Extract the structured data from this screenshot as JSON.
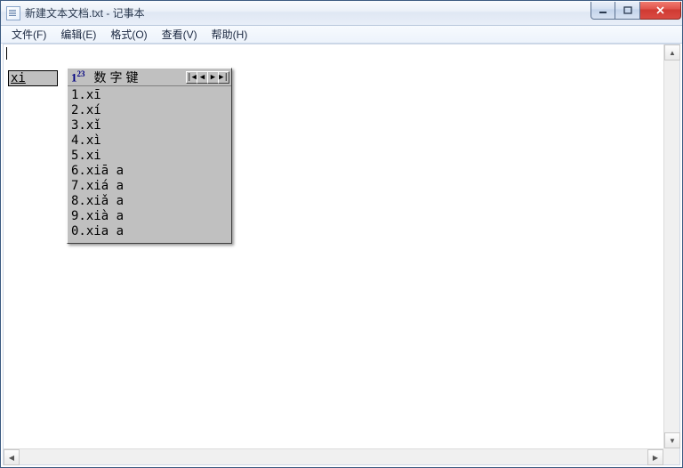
{
  "titlebar": {
    "title": "新建文本文档.txt - 记事本"
  },
  "menu": {
    "file": "文件(F)",
    "edit": "编辑(E)",
    "format": "格式(O)",
    "view": "查看(V)",
    "help": "帮助(H)"
  },
  "editor": {
    "content": ""
  },
  "ime": {
    "input": "xi",
    "mode_html": "1",
    "mode_sup": "23",
    "panel_title": "数字键",
    "nav": {
      "first": "|◀",
      "prev": "◀",
      "next": "▶",
      "last": "▶|"
    },
    "candidates": [
      {
        "n": "1",
        "text": "xī"
      },
      {
        "n": "2",
        "text": "xí"
      },
      {
        "n": "3",
        "text": "xǐ"
      },
      {
        "n": "4",
        "text": "xì"
      },
      {
        "n": "5",
        "text": "xi"
      },
      {
        "n": "6",
        "text": "xiā a"
      },
      {
        "n": "7",
        "text": "xiá a"
      },
      {
        "n": "8",
        "text": "xiǎ a"
      },
      {
        "n": "9",
        "text": "xià a"
      },
      {
        "n": "0",
        "text": "xia a"
      }
    ]
  },
  "scroll": {
    "up": "▲",
    "down": "▼",
    "left": "◀",
    "right": "▶"
  }
}
